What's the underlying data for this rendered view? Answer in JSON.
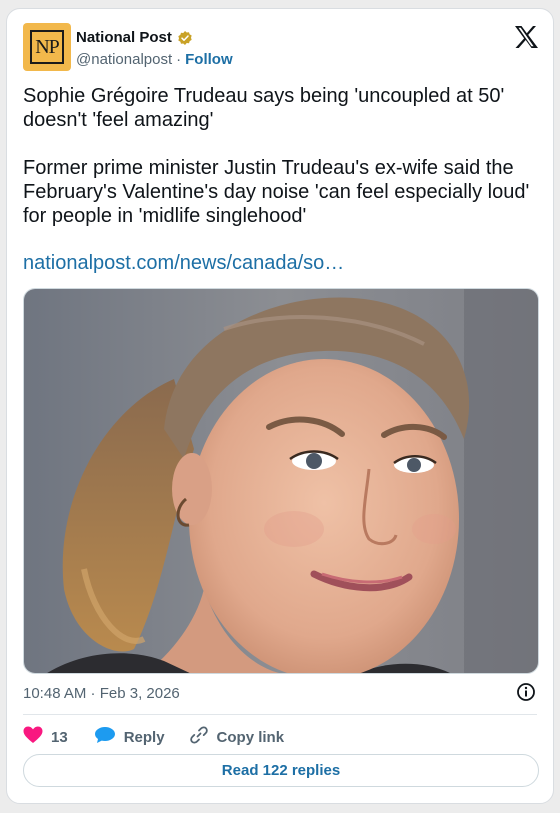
{
  "account": {
    "avatar_text": "NP",
    "name": "National Post",
    "handle": "@nationalpost",
    "separator": "·",
    "follow_label": "Follow"
  },
  "post": {
    "text": "Sophie Grégoire Trudeau says being 'uncoupled at 50' doesn't 'feel amazing'\n\nFormer prime minister Justin Trudeau's ex-wife said the February's Valentine's day noise 'can feel especially loud' for people in 'midlife singlehood'",
    "link": "nationalpost.com/news/canada/so…",
    "timestamp": "10:48 AM · Feb 3, 2026"
  },
  "actions": {
    "like_count": "13",
    "reply_label": "Reply",
    "copy_label": "Copy link"
  },
  "read_replies_label": "Read 122 replies",
  "colors": {
    "link": "#1d6fa5",
    "like": "#f91880",
    "reply": "#1d9bf0",
    "verified": "#c9a227",
    "avatar_bg": "#f2b84b"
  },
  "icons": [
    "verified-badge-icon",
    "x-logo-icon",
    "info-icon",
    "heart-icon",
    "reply-bubble-icon",
    "link-icon"
  ]
}
